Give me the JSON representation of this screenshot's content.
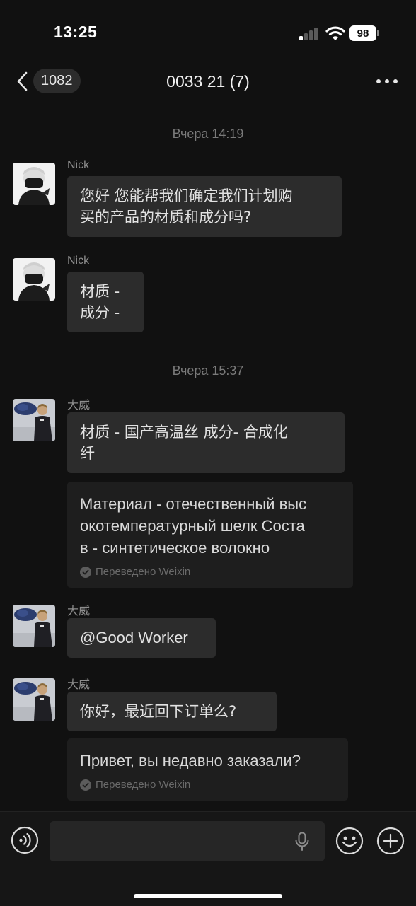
{
  "status_bar": {
    "time": "13:25",
    "battery": "98"
  },
  "nav": {
    "back_badge": "1082",
    "title": "0033 21 (7)"
  },
  "messages": [
    {
      "type": "timestamp",
      "text": "Вчера 14:19"
    },
    {
      "type": "message",
      "sender": "Nick",
      "lines": [
        "您好 您能帮我们确定我们计划购",
        "买的产品的材质和成分吗?"
      ]
    },
    {
      "type": "message",
      "sender": "Nick",
      "lines": [
        "材质 -",
        "成分 -"
      ]
    },
    {
      "type": "timestamp",
      "text": "Вчера 15:37"
    },
    {
      "type": "message",
      "sender": "大威",
      "lines": [
        "材质 - 国产高温丝  成分-  合成化",
        "纤"
      ],
      "translation": {
        "lines": [
          "Материал - отечественный выс",
          "окотемпературный шелк Соста",
          "в - синтетическое волокно"
        ],
        "source": "Переведено Weixin"
      }
    },
    {
      "type": "message",
      "sender": "大威",
      "lines": [
        "@Good Worker"
      ]
    },
    {
      "type": "message",
      "sender": "大威",
      "lines": [
        "你好，最近回下订单么?"
      ],
      "translation": {
        "lines": [
          "Привет, вы недавно заказали?"
        ],
        "source": "Переведено Weixin"
      }
    }
  ],
  "input": {
    "value": ""
  },
  "colors": {
    "background": "#111111",
    "bubble": "#2c2c2c",
    "translation_bubble": "#1e1e1e",
    "timestamp_text": "#7a7a7a"
  },
  "icons": {
    "back": "chevron-left-icon",
    "more": "more-horizontal-icon",
    "voice": "voice-icon",
    "mic": "microphone-icon",
    "emoji": "emoji-icon",
    "plus": "plus-icon",
    "verified": "check-circle-icon"
  }
}
